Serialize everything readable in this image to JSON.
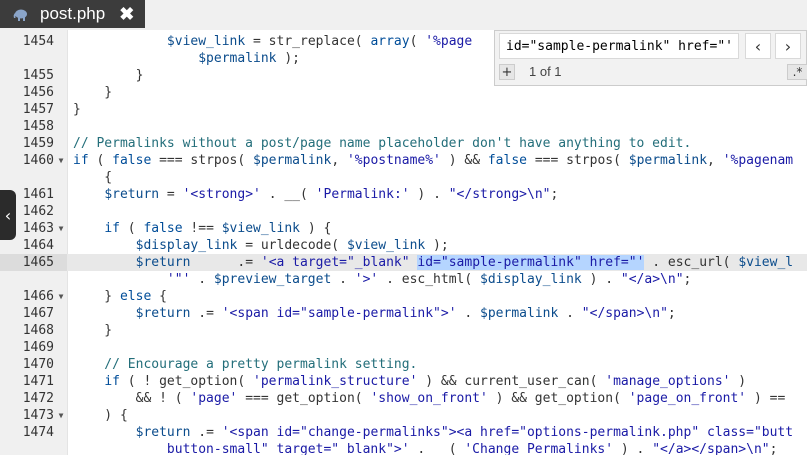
{
  "tab": {
    "title": "post.php",
    "close_glyph": "✖",
    "icon": "php-elephant-icon"
  },
  "side_handle": {
    "glyph": "‹",
    "icon": "chevron-left-icon"
  },
  "search": {
    "query": "id=\"sample-permalink\" href=\"'",
    "prev_glyph": "‹",
    "next_glyph": "›",
    "add_glyph": "+",
    "count": "1 of 1",
    "regex_label": ".*"
  },
  "colors": {
    "tab_bg": "#3c3c3c",
    "gutter_bg": "#f0f0f0",
    "active_line": "#e8e8e8",
    "selection": "#b5d5ff",
    "variable": "#0b4c8c",
    "string": "#1a1aa6",
    "comment": "#236e7a"
  },
  "lines": [
    {
      "num": "1454",
      "fold": false,
      "tokens": [
        {
          "c": "t-plain",
          "t": "            "
        },
        {
          "c": "t-var",
          "t": "$view_link"
        },
        {
          "c": "t-plain",
          "t": " = str_replace( "
        },
        {
          "c": "t-kw",
          "t": "array"
        },
        {
          "c": "t-plain",
          "t": "( "
        },
        {
          "c": "t-str",
          "t": "'%page"
        }
      ]
    },
    {
      "num": "",
      "fold": false,
      "tokens": [
        {
          "c": "t-plain",
          "t": "                "
        },
        {
          "c": "t-var",
          "t": "$permalink"
        },
        {
          "c": "t-plain",
          "t": " );"
        }
      ]
    },
    {
      "num": "1455",
      "fold": false,
      "tokens": [
        {
          "c": "t-plain",
          "t": "        }"
        }
      ]
    },
    {
      "num": "1456",
      "fold": false,
      "tokens": [
        {
          "c": "t-plain",
          "t": "    }"
        }
      ]
    },
    {
      "num": "1457",
      "fold": false,
      "tokens": [
        {
          "c": "t-plain",
          "t": "}"
        }
      ]
    },
    {
      "num": "1458",
      "fold": false,
      "tokens": []
    },
    {
      "num": "1459",
      "fold": false,
      "tokens": [
        {
          "c": "t-com",
          "t": "// Permalinks without a post/page name placeholder don't have anything to edit."
        }
      ]
    },
    {
      "num": "1460",
      "fold": true,
      "tokens": [
        {
          "c": "t-kw",
          "t": "if"
        },
        {
          "c": "t-plain",
          "t": " ( "
        },
        {
          "c": "t-kw",
          "t": "false"
        },
        {
          "c": "t-plain",
          "t": " === strpos( "
        },
        {
          "c": "t-var",
          "t": "$permalink"
        },
        {
          "c": "t-plain",
          "t": ", "
        },
        {
          "c": "t-str",
          "t": "'%postname%'"
        },
        {
          "c": "t-plain",
          "t": " ) && "
        },
        {
          "c": "t-kw",
          "t": "false"
        },
        {
          "c": "t-plain",
          "t": " === strpos( "
        },
        {
          "c": "t-var",
          "t": "$permalink"
        },
        {
          "c": "t-plain",
          "t": ", "
        },
        {
          "c": "t-str",
          "t": "'%pagenam"
        }
      ]
    },
    {
      "num": "",
      "fold": false,
      "tokens": [
        {
          "c": "t-plain",
          "t": "    {"
        }
      ]
    },
    {
      "num": "1461",
      "fold": false,
      "tokens": [
        {
          "c": "t-plain",
          "t": "    "
        },
        {
          "c": "t-var",
          "t": "$return"
        },
        {
          "c": "t-plain",
          "t": " = "
        },
        {
          "c": "t-str",
          "t": "'<strong>'"
        },
        {
          "c": "t-plain",
          "t": " . __( "
        },
        {
          "c": "t-str",
          "t": "'Permalink:'"
        },
        {
          "c": "t-plain",
          "t": " ) . "
        },
        {
          "c": "t-str",
          "t": "\"</strong>\\n\""
        },
        {
          "c": "t-plain",
          "t": ";"
        }
      ]
    },
    {
      "num": "1462",
      "fold": false,
      "tokens": []
    },
    {
      "num": "1463",
      "fold": true,
      "tokens": [
        {
          "c": "t-plain",
          "t": "    "
        },
        {
          "c": "t-kw",
          "t": "if"
        },
        {
          "c": "t-plain",
          "t": " ( "
        },
        {
          "c": "t-kw",
          "t": "false"
        },
        {
          "c": "t-plain",
          "t": " !== "
        },
        {
          "c": "t-var",
          "t": "$view_link"
        },
        {
          "c": "t-plain",
          "t": " ) {"
        }
      ]
    },
    {
      "num": "1464",
      "fold": false,
      "tokens": [
        {
          "c": "t-plain",
          "t": "        "
        },
        {
          "c": "t-var",
          "t": "$display_link"
        },
        {
          "c": "t-plain",
          "t": " = urldecode( "
        },
        {
          "c": "t-var",
          "t": "$view_link"
        },
        {
          "c": "t-plain",
          "t": " );"
        }
      ]
    },
    {
      "num": "1465",
      "fold": false,
      "active": true,
      "tokens": [
        {
          "c": "t-plain",
          "t": "        "
        },
        {
          "c": "t-var",
          "t": "$return"
        },
        {
          "c": "t-plain",
          "t": "      .= "
        },
        {
          "c": "t-str",
          "t": "'<a target=\"_blank\" "
        },
        {
          "c": "t-str sel",
          "t": "id=\"sample-permalink\" href=\"'"
        },
        {
          "c": "t-plain",
          "t": " . esc_url( "
        },
        {
          "c": "t-var",
          "t": "$view_l"
        }
      ]
    },
    {
      "num": "",
      "fold": false,
      "tokens": [
        {
          "c": "t-plain",
          "t": "            "
        },
        {
          "c": "t-str",
          "t": "'\"'"
        },
        {
          "c": "t-plain",
          "t": " . "
        },
        {
          "c": "t-var",
          "t": "$preview_target"
        },
        {
          "c": "t-plain",
          "t": " . "
        },
        {
          "c": "t-str",
          "t": "'>'"
        },
        {
          "c": "t-plain",
          "t": " . esc_html( "
        },
        {
          "c": "t-var",
          "t": "$display_link"
        },
        {
          "c": "t-plain",
          "t": " ) . "
        },
        {
          "c": "t-str",
          "t": "\"</a>\\n\""
        },
        {
          "c": "t-plain",
          "t": ";"
        }
      ]
    },
    {
      "num": "1466",
      "fold": true,
      "tokens": [
        {
          "c": "t-plain",
          "t": "    } "
        },
        {
          "c": "t-kw",
          "t": "else"
        },
        {
          "c": "t-plain",
          "t": " {"
        }
      ]
    },
    {
      "num": "1467",
      "fold": false,
      "tokens": [
        {
          "c": "t-plain",
          "t": "        "
        },
        {
          "c": "t-var",
          "t": "$return"
        },
        {
          "c": "t-plain",
          "t": " .= "
        },
        {
          "c": "t-str",
          "t": "'<span id=\"sample-permalink\">'"
        },
        {
          "c": "t-plain",
          "t": " . "
        },
        {
          "c": "t-var",
          "t": "$permalink"
        },
        {
          "c": "t-plain",
          "t": " . "
        },
        {
          "c": "t-str",
          "t": "\"</span>\\n\""
        },
        {
          "c": "t-plain",
          "t": ";"
        }
      ]
    },
    {
      "num": "1468",
      "fold": false,
      "tokens": [
        {
          "c": "t-plain",
          "t": "    }"
        }
      ]
    },
    {
      "num": "1469",
      "fold": false,
      "tokens": []
    },
    {
      "num": "1470",
      "fold": false,
      "tokens": [
        {
          "c": "t-com",
          "t": "    // Encourage a pretty permalink setting."
        }
      ]
    },
    {
      "num": "1471",
      "fold": false,
      "tokens": [
        {
          "c": "t-plain",
          "t": "    "
        },
        {
          "c": "t-kw",
          "t": "if"
        },
        {
          "c": "t-plain",
          "t": " ( ! get_option( "
        },
        {
          "c": "t-str",
          "t": "'permalink_structure'"
        },
        {
          "c": "t-plain",
          "t": " ) && current_user_can( "
        },
        {
          "c": "t-str",
          "t": "'manage_options'"
        },
        {
          "c": "t-plain",
          "t": " )"
        }
      ]
    },
    {
      "num": "1472",
      "fold": false,
      "tokens": [
        {
          "c": "t-plain",
          "t": "        && ! ( "
        },
        {
          "c": "t-str",
          "t": "'page'"
        },
        {
          "c": "t-plain",
          "t": " === get_option( "
        },
        {
          "c": "t-str",
          "t": "'show_on_front'"
        },
        {
          "c": "t-plain",
          "t": " ) && get_option( "
        },
        {
          "c": "t-str",
          "t": "'page_on_front'"
        },
        {
          "c": "t-plain",
          "t": " ) =="
        }
      ]
    },
    {
      "num": "1473",
      "fold": true,
      "tokens": [
        {
          "c": "t-plain",
          "t": "    ) {"
        }
      ]
    },
    {
      "num": "1474",
      "fold": false,
      "tokens": [
        {
          "c": "t-plain",
          "t": "        "
        },
        {
          "c": "t-var",
          "t": "$return"
        },
        {
          "c": "t-plain",
          "t": " .= "
        },
        {
          "c": "t-str",
          "t": "'<span id=\"change-permalinks\"><a href=\"options-permalink.php\" class=\"butt"
        }
      ]
    },
    {
      "num": "",
      "fold": false,
      "tokens": [
        {
          "c": "t-plain",
          "t": "            "
        },
        {
          "c": "t-str",
          "t": "button-small\" target=\" blank\">'"
        },
        {
          "c": "t-plain",
          "t": " . __( "
        },
        {
          "c": "t-str",
          "t": "'Change Permalinks'"
        },
        {
          "c": "t-plain",
          "t": " ) . "
        },
        {
          "c": "t-str",
          "t": "\"</a></span>\\n\""
        },
        {
          "c": "t-plain",
          "t": ";"
        }
      ]
    }
  ]
}
